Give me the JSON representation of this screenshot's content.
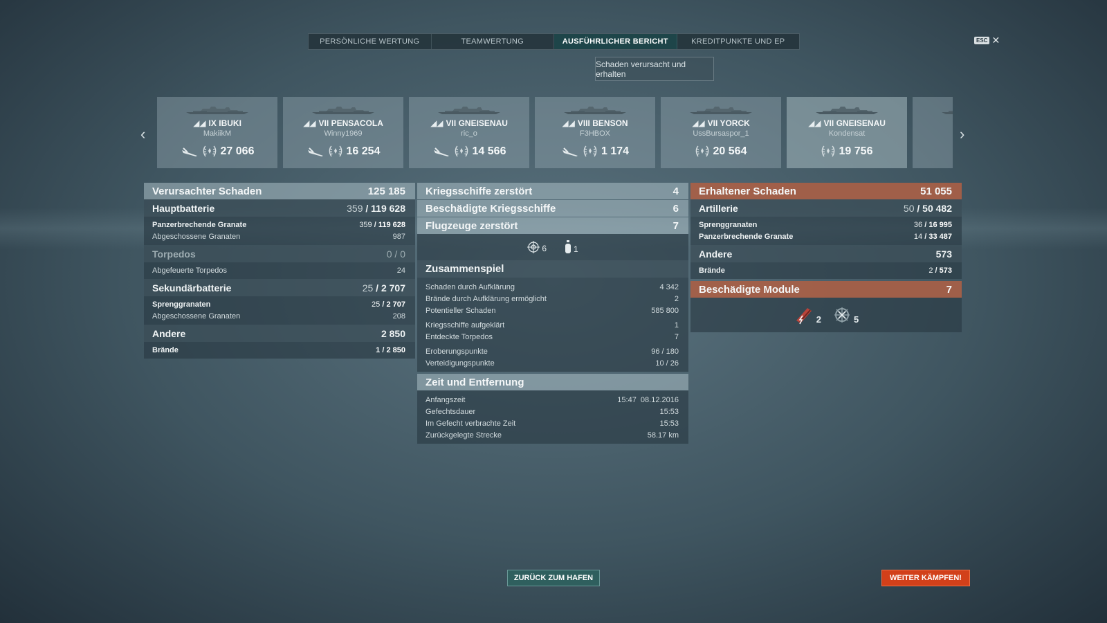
{
  "tabs": [
    {
      "label": "PERSÖNLICHE WERTUNG"
    },
    {
      "label": "TEAMWERTUNG"
    },
    {
      "label": "AUSFÜHRLICHER BERICHT"
    },
    {
      "label": "KREDITPUNKTE UND EP"
    }
  ],
  "active_tab": "AUSFÜHRLICHER BERICHT",
  "esc": {
    "key": "ESC",
    "close": "✕"
  },
  "dropdown": {
    "value": "Schaden verursacht und erhalten"
  },
  "nav": {
    "prev": "‹",
    "next": "›"
  },
  "ships": [
    {
      "tier": "IX",
      "name": "IBUKI",
      "player": "MakiikM",
      "damage": "27 066",
      "has_plane": true
    },
    {
      "tier": "VII",
      "name": "PENSACOLA",
      "player": "Winny1969",
      "damage": "16 254",
      "has_plane": true
    },
    {
      "tier": "VII",
      "name": "GNEISENAU",
      "player": "ric_o",
      "damage": "14 566",
      "has_plane": true
    },
    {
      "tier": "VIII",
      "name": "BENSON",
      "player": "F3HBOX",
      "damage": "1 174",
      "has_plane": true
    },
    {
      "tier": "VII",
      "name": "YORCK",
      "player": "UssBursaspor_1",
      "damage": "20 564",
      "has_plane": false
    },
    {
      "tier": "VII",
      "name": "GNEISENAU",
      "player": "Kondensat",
      "damage": "19 756",
      "has_plane": false
    }
  ],
  "dealt": {
    "title": "Verursachter Schaden",
    "total": "125 185",
    "main": {
      "label": "Hauptbatterie",
      "hits": "359",
      "dmg": "119 628"
    },
    "main_rows": [
      {
        "label": "Panzerbrechende Granate",
        "hits": "359",
        "dmg": "119 628"
      },
      {
        "label": "Abgeschossene Granaten",
        "value": "987"
      }
    ],
    "torp": {
      "label": "Torpedos",
      "hits": "0",
      "dmg": "0"
    },
    "torp_rows": [
      {
        "label": "Abgefeuerte Torpedos",
        "value": "24"
      }
    ],
    "sec": {
      "label": "Sekundärbatterie",
      "hits": "25",
      "dmg": "2 707"
    },
    "sec_rows": [
      {
        "label": "Sprenggranaten",
        "hits": "25",
        "dmg": "2 707"
      },
      {
        "label": "Abgeschossene Granaten",
        "value": "208"
      }
    ],
    "other": {
      "label": "Andere",
      "value": "2 850"
    },
    "other_rows": [
      {
        "label": "Brände",
        "hits": "1",
        "dmg": "2 850"
      }
    ]
  },
  "middle": {
    "kills": {
      "label": "Kriegsschiffe zerstört",
      "value": "4"
    },
    "damaged": {
      "label": "Beschädigte Kriegsschiffe",
      "value": "6"
    },
    "planes": {
      "label": "Flugzeuge zerstört",
      "value": "7"
    },
    "plane_types": [
      {
        "icon": "fighter-icon",
        "count": "6"
      },
      {
        "icon": "bomber-icon",
        "count": "1"
      }
    ],
    "teamwork": {
      "label": "Zusammenspiel"
    },
    "teamwork_rows": [
      [
        {
          "label": "Schaden durch Aufklärung",
          "value": "4 342"
        },
        {
          "label": "Brände durch Aufklärung ermöglicht",
          "value": "2"
        },
        {
          "label": "Potentieller Schaden",
          "value": "585 800"
        }
      ],
      [
        {
          "label": "Kriegsschiffe aufgeklärt",
          "value": "1"
        },
        {
          "label": "Entdeckte Torpedos",
          "value": "7"
        }
      ],
      [
        {
          "label": "Eroberungspunkte",
          "value": "96 / 180"
        },
        {
          "label": "Verteidigungspunkte",
          "value": "10 / 26"
        }
      ]
    ],
    "time": {
      "label": "Zeit und Entfernung"
    },
    "time_rows": [
      {
        "label": "Anfangszeit",
        "value": "15:47  08.12.2016"
      },
      {
        "label": "Gefechtsdauer",
        "value": "15:53"
      },
      {
        "label": "Im Gefecht verbrachte Zeit",
        "value": "15:53"
      },
      {
        "label": "Zurückgelegte Strecke",
        "value": "58.17 km"
      }
    ]
  },
  "received": {
    "title": "Erhaltener Schaden",
    "total": "51 055",
    "art": {
      "label": "Artillerie",
      "hits": "50",
      "dmg": "50 482"
    },
    "art_rows": [
      {
        "label": "Sprenggranaten",
        "hits": "36",
        "dmg": "16 995"
      },
      {
        "label": "Panzerbrechende Granate",
        "hits": "14",
        "dmg": "33 487"
      }
    ],
    "other": {
      "label": "Andere",
      "value": "573"
    },
    "other_rows": [
      {
        "label": "Brände",
        "hits": "2",
        "dmg": "573"
      }
    ],
    "modules": {
      "label": "Beschädigte Module",
      "value": "7"
    },
    "module_icons": [
      {
        "icon": "gun-module-icon",
        "count": "2"
      },
      {
        "icon": "rudder-module-icon",
        "count": "5"
      }
    ]
  },
  "buttons": {
    "port": "ZURÜCK ZUM HAFEN",
    "fight": "WEITER KÄMPFEN!"
  }
}
